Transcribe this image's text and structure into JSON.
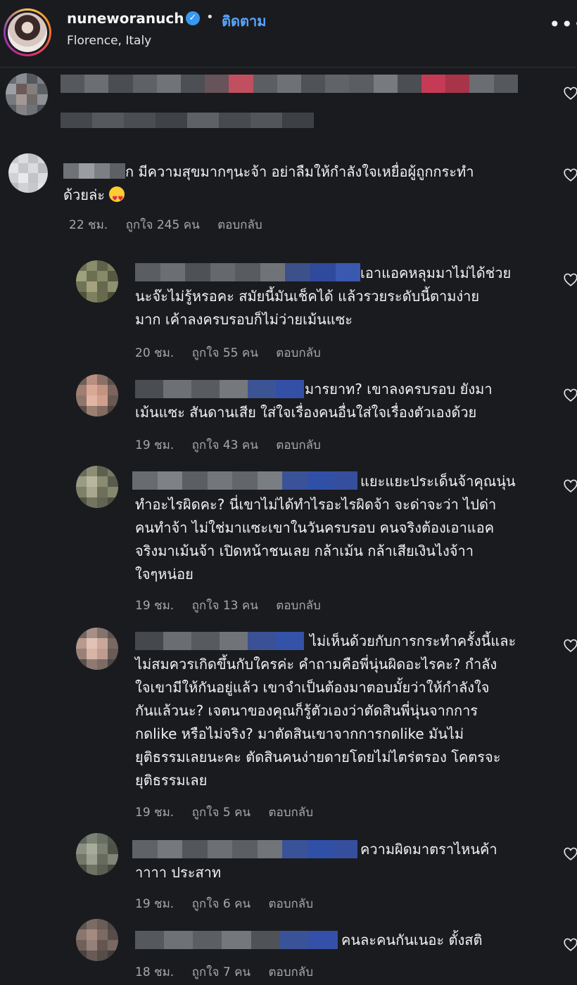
{
  "header": {
    "username": "nuneworanuch",
    "verified_glyph": "✓",
    "separator": "•",
    "follow_label": "ติดตาม",
    "location": "Florence, Italy",
    "more_glyph": "•••"
  },
  "comments": [
    {
      "text_line1": "ก มีความสุขมากๆนะจ้า อย่าลืมให้กำลังใจเหยื่อผู้ถูกกระทำ",
      "text_line2": "ด้วยล่ะ",
      "time": "22 ชม.",
      "likes": "ถูกใจ 245 คน",
      "reply": "ตอบกลับ"
    },
    {
      "text_line1": "เอาแอคหลุมมาไม่ได้ช่วย",
      "text_line2": "นะจ๊ะไม่รู้หรอคะ สมัยนี้มันเช็คได้ แล้วรวยระดับนี้ตามง่าย",
      "text_line3": "มาก เค้าลงครบรอบก็ไม่ว่ายเม้นแซะ",
      "time": "20 ชม.",
      "likes": "ถูกใจ 55 คน",
      "reply": "ตอบกลับ"
    },
    {
      "text_line1": "มารยาท? เขาลงครบรอบ ยังมา",
      "text_line2": "เม้นแซะ สันดานเสีย ใส่ใจเรื่องคนอื่นใส่ใจเรื่องตัวเองด้วย",
      "time": "19 ชม.",
      "likes": "ถูกใจ 43 คน",
      "reply": "ตอบกลับ"
    },
    {
      "text_line1": "แยะแยะประเด็นจ้าคุณนุ่น",
      "text_line2": "ทำอะไรผิดคะ? นี่เขาไม่ได้ทำไรอะไรผิดจ้า จะด่าจะว่า ไปด่า",
      "text_line3": "คนทำจ้า ไม่ใช่มาแซะเขาในวันครบรอบ คนจริงต้องเอาแอค",
      "text_line4": "จริงมาเม้นจ้า เปิดหน้าชนเลย กล้าเม้น กล้าเสียเงินไงจ้าา",
      "text_line5": "ใจๆหน่อย",
      "time": "19 ชม.",
      "likes": "ถูกใจ 13 คน",
      "reply": "ตอบกลับ"
    },
    {
      "text_line1": "ไม่เห็นด้วยกับการกระทำครั้งนี้และ",
      "text_line2": "ไม่สมควรเกิดขึ้นกับใครค่ะ คำถามคือพี่นุ่นผิดอะไรคะ? กำลัง",
      "text_line3": "ใจเขามีให้กันอยู่แล้ว เขาจำเป็นต้องมาตอบมั้ยว่าให้กำลังใจ",
      "text_line4": "กันแล้วนะ? เจตนาของคุณก็รู้ตัวเองว่าตัดสินพี่นุ่นจากการ",
      "text_line5": "กดlike หรือไม่จริง? มาตัดสินเขาจากการกดlike มันไม่",
      "text_line6": "ยุติธรรมเลยนะคะ ตัดสินคนง่ายดายโดยไม่ไตร่ตรอง โคตรจะ",
      "text_line7": "ยุติธรรมเลย",
      "time": "19 ชม.",
      "likes": "ถูกใจ 5 คน",
      "reply": "ตอบกลับ"
    },
    {
      "text_line1": "ความผิดมาตราไหนค้า",
      "text_line2": "าาาา ประสาท",
      "time": "19 ชม.",
      "likes": "ถูกใจ 6 คน",
      "reply": "ตอบกลับ"
    },
    {
      "text_line1": "คนละคนกันเนอะ ตั้งสติ",
      "time": "18 ชม.",
      "likes": "ถูกใจ 7 คน",
      "reply": "ตอบกลับ"
    }
  ],
  "icons": {
    "heart": "heart-outline-icon",
    "verified": "verified-badge-icon",
    "more": "more-options-icon"
  },
  "colors": {
    "background": "#1a1b1f",
    "link_blue": "#58a6ff",
    "verified_blue": "#3897f0",
    "meta_gray": "#a8a8a8"
  }
}
